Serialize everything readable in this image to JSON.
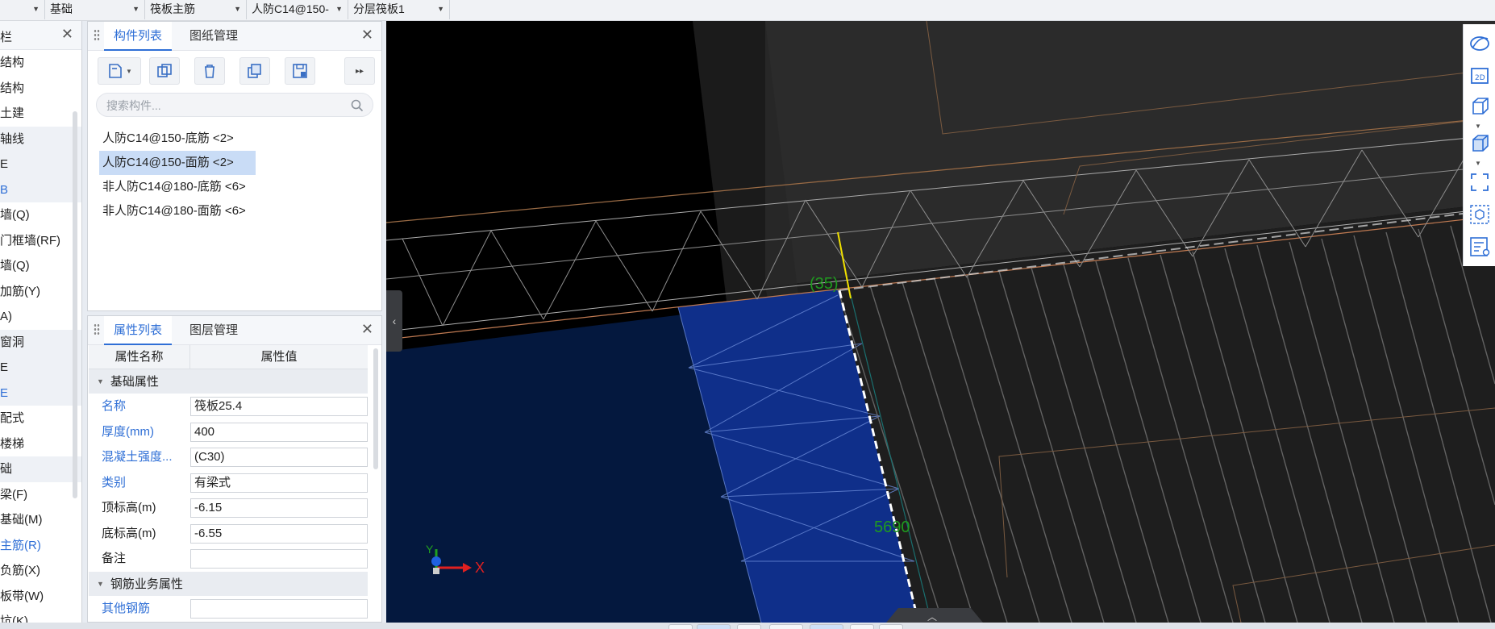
{
  "topbar": {
    "dropdowns": [
      "基础",
      "筏板主筋",
      "人防C14@150-",
      "分层筏板1"
    ]
  },
  "leftnav": {
    "title": "栏",
    "items": [
      {
        "label": "结构",
        "style": ""
      },
      {
        "label": "结构",
        "style": ""
      },
      {
        "label": "土建",
        "style": ""
      },
      {
        "label": "轴线",
        "style": "grey"
      },
      {
        "label": "E",
        "style": "grey"
      },
      {
        "label": "B",
        "style": "grey blue"
      },
      {
        "label": "墙(Q)",
        "style": ""
      },
      {
        "label": "门框墙(RF)",
        "style": ""
      },
      {
        "label": "墙(Q)",
        "style": ""
      },
      {
        "label": "加筋(Y)",
        "style": ""
      },
      {
        "label": "A)",
        "style": ""
      },
      {
        "label": "窗洞",
        "style": "grey"
      },
      {
        "label": "E",
        "style": "grey"
      },
      {
        "label": "E",
        "style": "grey blue"
      },
      {
        "label": "配式",
        "style": ""
      },
      {
        "label": "楼梯",
        "style": ""
      },
      {
        "label": "础",
        "style": "grey"
      },
      {
        "label": "梁(F)",
        "style": ""
      },
      {
        "label": "基础(M)",
        "style": ""
      },
      {
        "label": "主筋(R)",
        "style": "blue"
      },
      {
        "label": "负筋(X)",
        "style": ""
      },
      {
        "label": "板带(W)",
        "style": ""
      },
      {
        "label": "坑(K)",
        "style": ""
      }
    ]
  },
  "component_panel": {
    "tabs": [
      "构件列表",
      "图纸管理"
    ],
    "search_placeholder": "搜索构件...",
    "items": [
      {
        "label": "人防C14@150-底筋 <2>",
        "selected": false
      },
      {
        "label": "人防C14@150-面筋 <2>",
        "selected": true
      },
      {
        "label": "非人防C14@180-底筋 <6>",
        "selected": false
      },
      {
        "label": "非人防C14@180-面筋 <6>",
        "selected": false
      }
    ]
  },
  "property_panel": {
    "tabs": [
      "属性列表",
      "图层管理"
    ],
    "header": {
      "name": "属性名称",
      "value": "属性值"
    },
    "group1": "基础属性",
    "rows": [
      {
        "key": "名称",
        "value": "筏板25.4",
        "blue": true
      },
      {
        "key": "厚度(mm)",
        "value": "400",
        "blue": true
      },
      {
        "key": "混凝土强度...",
        "value": "(C30)",
        "blue": true
      },
      {
        "key": "类别",
        "value": "有梁式",
        "blue": true
      },
      {
        "key": "顶标高(m)",
        "value": "-6.15",
        "blue": false
      },
      {
        "key": "底标高(m)",
        "value": "-6.55",
        "blue": false
      },
      {
        "key": "备注",
        "value": "",
        "blue": false
      }
    ],
    "group2": "钢筋业务属性",
    "rows2": [
      {
        "key": "其他钢筋",
        "value": "",
        "blue": true
      }
    ]
  },
  "viewport": {
    "dimension_labels": [
      "(35)",
      "5690"
    ],
    "axis_x": "X",
    "axis_y": "Y"
  },
  "colors": {
    "accent": "#2f6fd6",
    "dimension_text": "#1f9a1f",
    "slab_blue": "#0f2f8a"
  }
}
